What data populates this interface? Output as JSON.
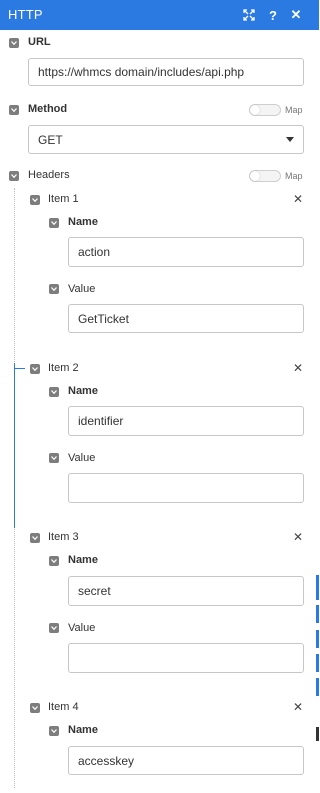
{
  "window": {
    "title": "HTTP"
  },
  "url": {
    "label": "URL",
    "value": "https://whmcs domain/includes/api.php"
  },
  "method": {
    "label": "Method",
    "value": "GET",
    "map_label": "Map"
  },
  "headers": {
    "label": "Headers",
    "map_label": "Map",
    "items": [
      {
        "title": "Item 1",
        "name_label": "Name",
        "name_value": "action",
        "value_label": "Value",
        "value_value": "GetTicket"
      },
      {
        "title": "Item 2",
        "name_label": "Name",
        "name_value": "identifier",
        "value_label": "Value",
        "value_value": ""
      },
      {
        "title": "Item 3",
        "name_label": "Name",
        "name_value": "secret",
        "value_label": "Value",
        "value_value": ""
      },
      {
        "title": "Item 4",
        "name_label": "Name",
        "name_value": "accesskey"
      }
    ]
  },
  "colors": {
    "titlebar": "#2a7ae2",
    "accent_line": "#2a7ae2"
  }
}
